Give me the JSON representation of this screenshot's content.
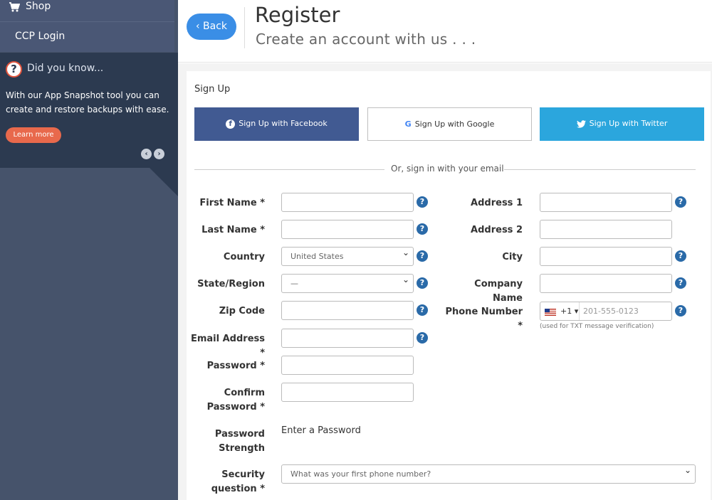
{
  "sidebar": {
    "shop_label": "Shop",
    "ccp_label": "CCP Login",
    "did_you_know": {
      "title": "Did you know...",
      "body": "With our App Snapshot tool you can create and restore backups with ease.",
      "learn_more": "Learn more",
      "prev_glyph": "‹",
      "next_glyph": "›"
    }
  },
  "header": {
    "back_label": "Back",
    "title": "Register",
    "subtitle": "Create an account with us . . ."
  },
  "form": {
    "section_label": "Sign Up",
    "social": {
      "facebook": "Sign Up with Facebook",
      "google": "Sign Up with Google",
      "twitter": "Sign Up with Twitter"
    },
    "divider_text": "Or, sign in with your email",
    "left": {
      "first_name": "First Name *",
      "last_name": "Last Name *",
      "country": "Country",
      "country_value": "United States",
      "state": "State/Region",
      "state_value": "—",
      "zip": "Zip Code",
      "email": "Email Address *",
      "password": "Password *",
      "confirm_1": "Confirm",
      "confirm_2": "Password *",
      "strength_1": "Password",
      "strength_2": "Strength",
      "strength_value": "Enter a Password",
      "security_1": "Security",
      "security_2": "question *",
      "security_value": "What was your first phone number?"
    },
    "right": {
      "address1": "Address 1",
      "address2": "Address 2",
      "city": "City",
      "company": "Company Name",
      "phone_1": "Phone Number",
      "phone_2": "*",
      "phone_prefix": "+1 ▾",
      "phone_placeholder": "201-555-0123",
      "phone_hint": "(used for TXT message verification)"
    },
    "help_glyph": "?"
  },
  "colors": {
    "facebook": "#415a92",
    "twitter": "#2ba6dd",
    "back": "#3a8ee6",
    "learn_more": "#e8694c",
    "sidebar": "#46536b",
    "help": "#2a6aa8"
  }
}
